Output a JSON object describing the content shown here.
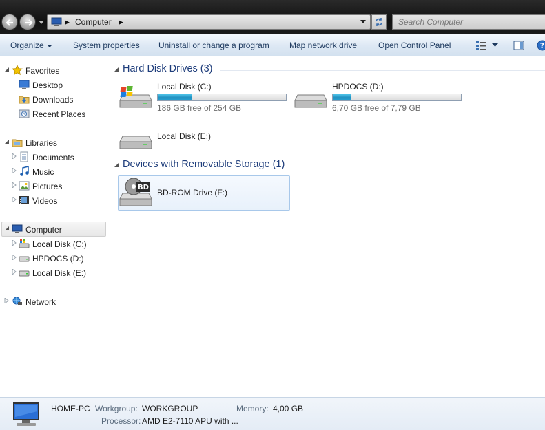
{
  "window": {
    "address": {
      "crumb": "Computer"
    },
    "search": {
      "placeholder": "Search Computer"
    }
  },
  "toolbar": {
    "organize": "Organize",
    "system_properties": "System properties",
    "uninstall": "Uninstall or change a program",
    "map_drive": "Map network drive",
    "control_panel": "Open Control Panel"
  },
  "nav": {
    "favorites": {
      "label": "Favorites",
      "items": [
        "Desktop",
        "Downloads",
        "Recent Places"
      ]
    },
    "libraries": {
      "label": "Libraries",
      "items": [
        "Documents",
        "Music",
        "Pictures",
        "Videos"
      ]
    },
    "computer": {
      "label": "Computer",
      "items": [
        "Local Disk (C:)",
        "HPDOCS (D:)",
        "Local Disk (E:)"
      ]
    },
    "network": {
      "label": "Network"
    }
  },
  "main": {
    "hard_disks": {
      "header": "Hard Disk Drives (3)",
      "drives": [
        {
          "name": "Local Disk (C:)",
          "free": "186 GB free of 254 GB",
          "used_fraction": 0.27
        },
        {
          "name": "HPDOCS (D:)",
          "free": "6,70 GB free of 7,79 GB",
          "used_fraction": 0.14
        },
        {
          "name": "Local Disk (E:)"
        }
      ]
    },
    "removable": {
      "header": "Devices with Removable Storage (1)",
      "drives": [
        {
          "name": "BD-ROM Drive (F:)",
          "badge": "BD"
        }
      ]
    }
  },
  "details": {
    "computer_name": "HOME-PC",
    "workgroup_label": "Workgroup:",
    "workgroup_value": "WORKGROUP",
    "memory_label": "Memory:",
    "memory_value": "4,00 GB",
    "processor_label": "Processor:",
    "processor_value": "AMD E2-7110 APU with ..."
  },
  "colors": {
    "toolbar_text": "#1e3a5f",
    "group_header": "#1e3d7b",
    "bar_fill": "#1f8fbf"
  }
}
